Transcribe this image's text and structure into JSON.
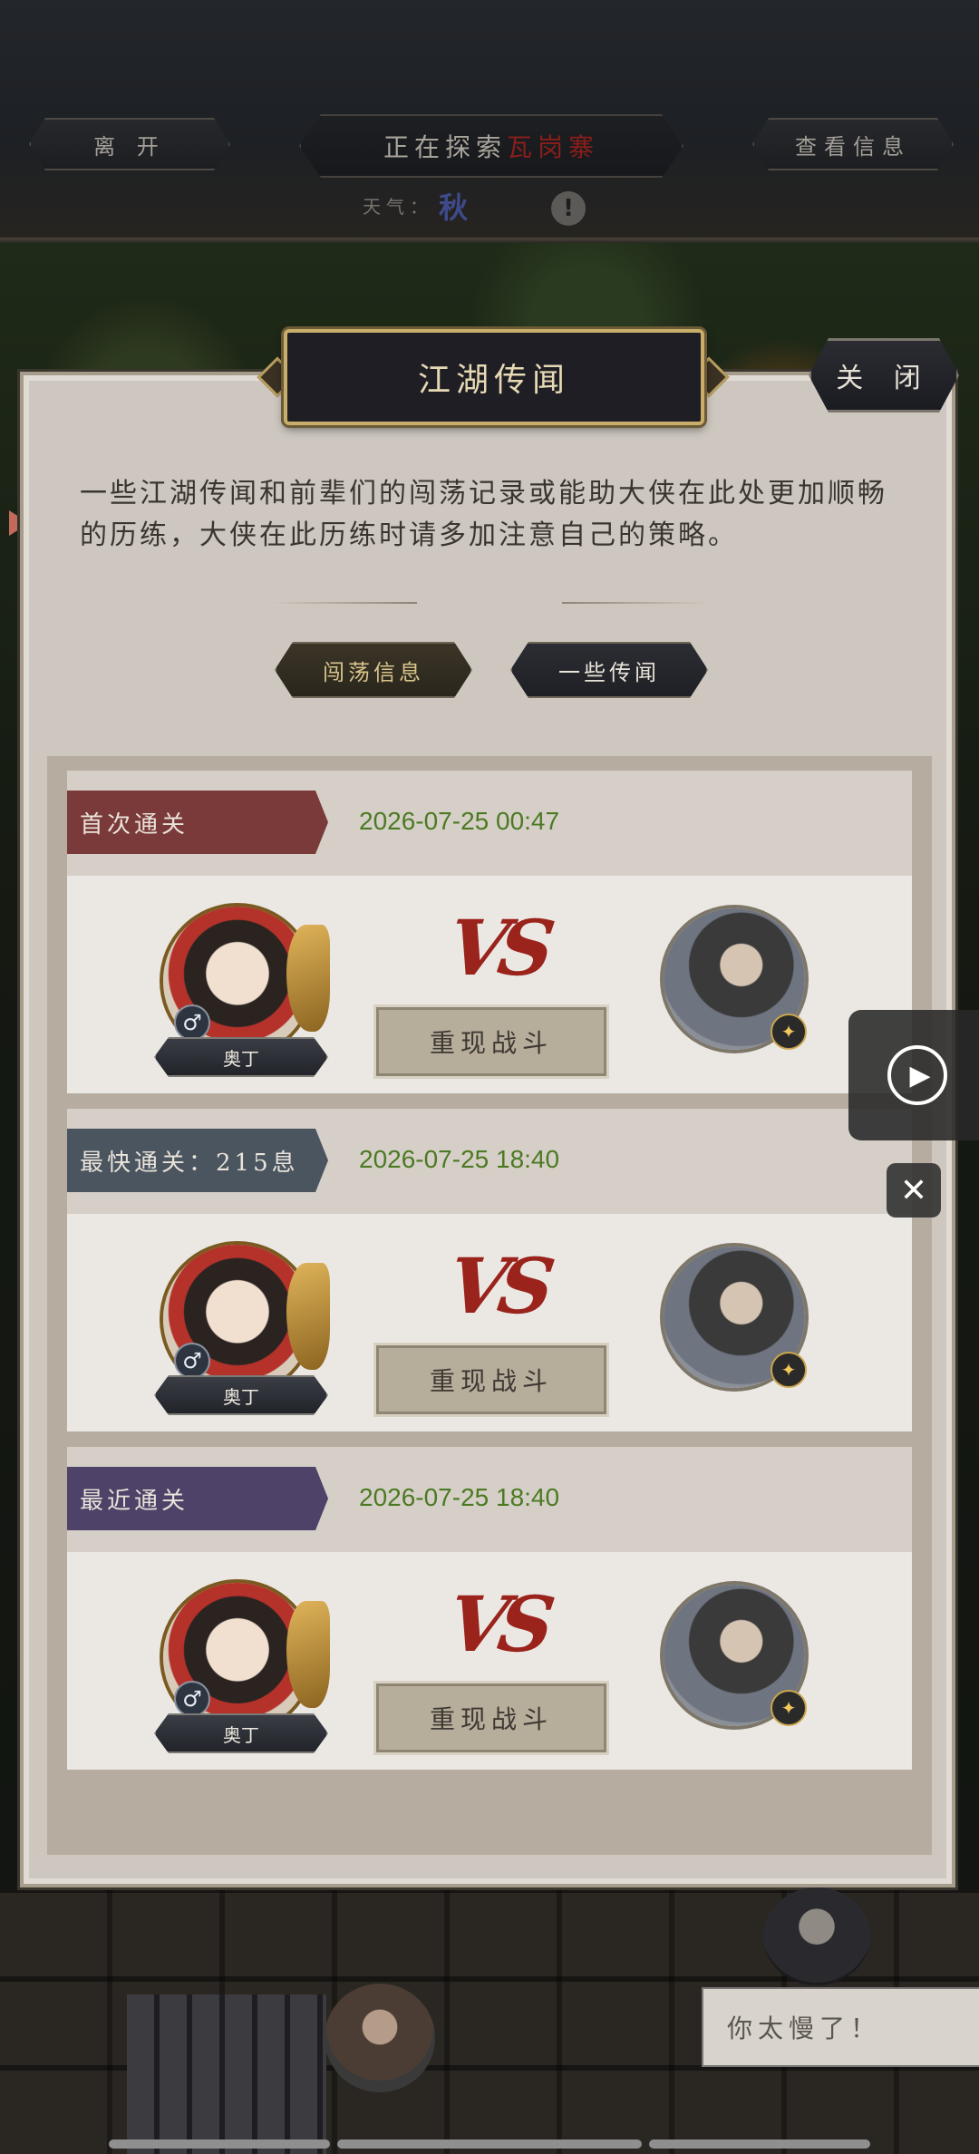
{
  "topbar": {
    "leave_label": "离 开",
    "exploring_prefix": "正在探索",
    "exploring_location": "瓦岗寨",
    "info_label": "查看信息",
    "weather_label": "天气：",
    "weather_glyph": "秋"
  },
  "modal": {
    "title": "江湖传闻",
    "close_label": "关 闭",
    "intro": "一些江湖传闻和前辈们的闯荡记录或能助大侠在此处更加顺畅的历练，大侠在此历练时请多加注意自己的策略。",
    "tabs": [
      {
        "label": "闯荡信息"
      },
      {
        "label": "一些传闻"
      }
    ],
    "records": [
      {
        "label": "首次通关",
        "time": "2026-07-25 00:47",
        "hero_name": "奥丁",
        "vs": "VS",
        "replay_label": "重现战斗",
        "label_color": "#7a3a3a"
      },
      {
        "label": "最快通关：215息",
        "time": "2026-07-25 18:40",
        "hero_name": "奥丁",
        "vs": "VS",
        "replay_label": "重现战斗",
        "label_color": "#4a5560"
      },
      {
        "label": "最近通关",
        "time": "2026-07-25 18:40",
        "hero_name": "奥丁",
        "vs": "VS",
        "replay_label": "重现战斗",
        "label_color": "#4e4268"
      }
    ]
  },
  "gender_symbol": "♂",
  "chat_bubble": "你太慢了！",
  "icons": {
    "play": "play-icon",
    "close_overlay": "close-icon",
    "info": "info-icon"
  }
}
